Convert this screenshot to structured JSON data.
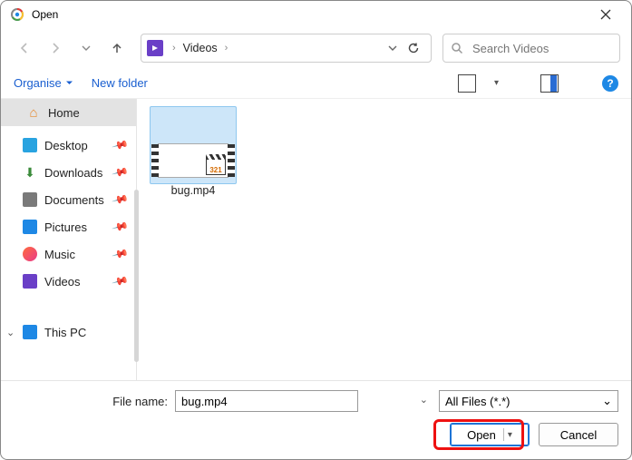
{
  "dialog": {
    "title": "Open"
  },
  "breadcrumb": {
    "location": "Videos"
  },
  "search": {
    "placeholder": "Search Videos"
  },
  "toolbar": {
    "organise": "Organise",
    "newfolder": "New folder"
  },
  "sidebar": {
    "home": "Home",
    "items": [
      {
        "label": "Desktop"
      },
      {
        "label": "Downloads"
      },
      {
        "label": "Documents"
      },
      {
        "label": "Pictures"
      },
      {
        "label": "Music"
      },
      {
        "label": "Videos"
      }
    ],
    "thispc": "This PC"
  },
  "files": {
    "item0": {
      "name": "bug.mp4"
    }
  },
  "footer": {
    "filename_label": "File name:",
    "filename_value": "bug.mp4",
    "filter": "All Files (*.*)",
    "open": "Open",
    "cancel": "Cancel"
  }
}
